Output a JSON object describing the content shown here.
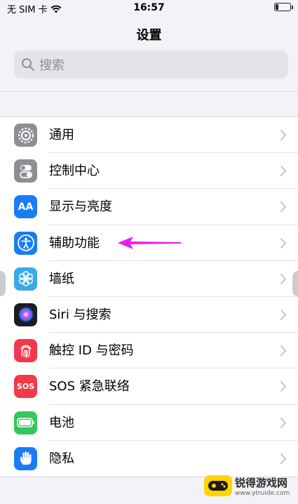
{
  "status_bar": {
    "carrier": "无 SIM 卡",
    "time": "16:57",
    "battery_level": 0.2
  },
  "nav": {
    "title": "设置"
  },
  "search": {
    "placeholder": "搜索"
  },
  "rows": [
    {
      "label": "通用",
      "icon": "gear-icon",
      "color": "#8e8e93"
    },
    {
      "label": "控制中心",
      "icon": "toggles-icon",
      "color": "#8e8e93"
    },
    {
      "label": "显示与亮度",
      "icon": "text-size-icon",
      "color": "#1a7cf5",
      "icon_text": "AA"
    },
    {
      "label": "辅助功能",
      "icon": "accessibility-icon",
      "color": "#1a7cf5"
    },
    {
      "label": "墙纸",
      "icon": "flower-icon",
      "color": "#3aa9e6"
    },
    {
      "label": "Siri 与搜索",
      "icon": "siri-icon",
      "color": "#1c1c24"
    },
    {
      "label": "触控 ID 与密码",
      "icon": "fingerprint-icon",
      "color": "#f03a4a"
    },
    {
      "label": "SOS 紧急联络",
      "icon": "sos-icon",
      "color": "#f03a4a",
      "icon_text": "SOS"
    },
    {
      "label": "电池",
      "icon": "battery-icon",
      "color": "#34c759"
    },
    {
      "label": "隐私",
      "icon": "hand-icon",
      "color": "#1a7cf5"
    }
  ],
  "watermark": {
    "main": "锐得游戏网",
    "sub": "www.ytruide.com"
  },
  "colors": {
    "annotation_arrow": "#e81ee8"
  }
}
